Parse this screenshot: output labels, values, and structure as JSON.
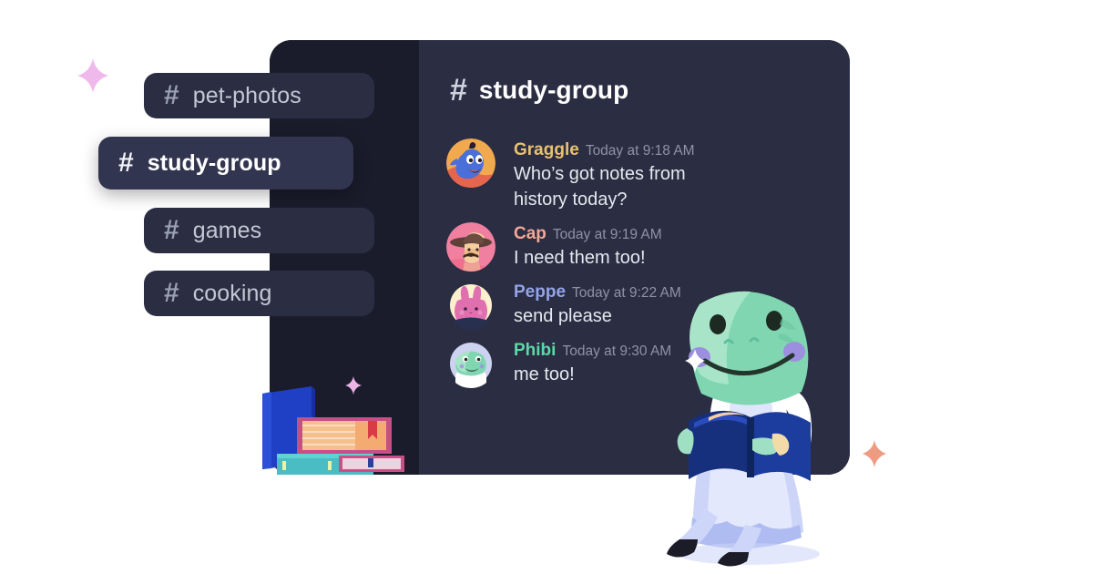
{
  "window": {
    "background_color": "#ffffff",
    "panel_color": "#2b2d42",
    "sidebar_color": "#1b1c2b"
  },
  "sidebar": {
    "channels": [
      {
        "hash": "#",
        "label": "pet-photos",
        "active": false
      },
      {
        "hash": "#",
        "label": "study-group",
        "active": true
      },
      {
        "hash": "#",
        "label": "games",
        "active": false
      },
      {
        "hash": "#",
        "label": "cooking",
        "active": false
      }
    ]
  },
  "header": {
    "hash": "#",
    "title": "study-group"
  },
  "messages": [
    {
      "author": "Graggle",
      "author_color": "#e8c170",
      "timestamp": "Today at 9:18 AM",
      "text": "Who’s got notes from history today?",
      "avatar": "genie-avatar"
    },
    {
      "author": "Cap",
      "author_color": "#f2a896",
      "timestamp": "Today at 9:19 AM",
      "text": "I need them too!",
      "avatar": "explorer-avatar"
    },
    {
      "author": "Peppe",
      "author_color": "#93a4e8",
      "timestamp": "Today at 9:22 AM",
      "text": "send please",
      "avatar": "bunny-avatar"
    },
    {
      "author": "Phibi",
      "author_color": "#5dd8a8",
      "timestamp": "Today at 9:30 AM",
      "text": "me too!",
      "avatar": "frog-avatar"
    }
  ],
  "decorations": {
    "sparkles": [
      {
        "name": "sparkle-pink-top-left",
        "color": "#f0b9ec"
      },
      {
        "name": "sparkle-pink-books",
        "color": "#e9b6e6"
      },
      {
        "name": "sparkle-white-messages",
        "color": "#ffffff"
      },
      {
        "name": "sparkle-salmon-bottom-right",
        "color": "#ef9b82"
      }
    ],
    "illustrations": [
      {
        "name": "book-stack-illustration"
      },
      {
        "name": "frog-reading-illustration"
      }
    ]
  }
}
